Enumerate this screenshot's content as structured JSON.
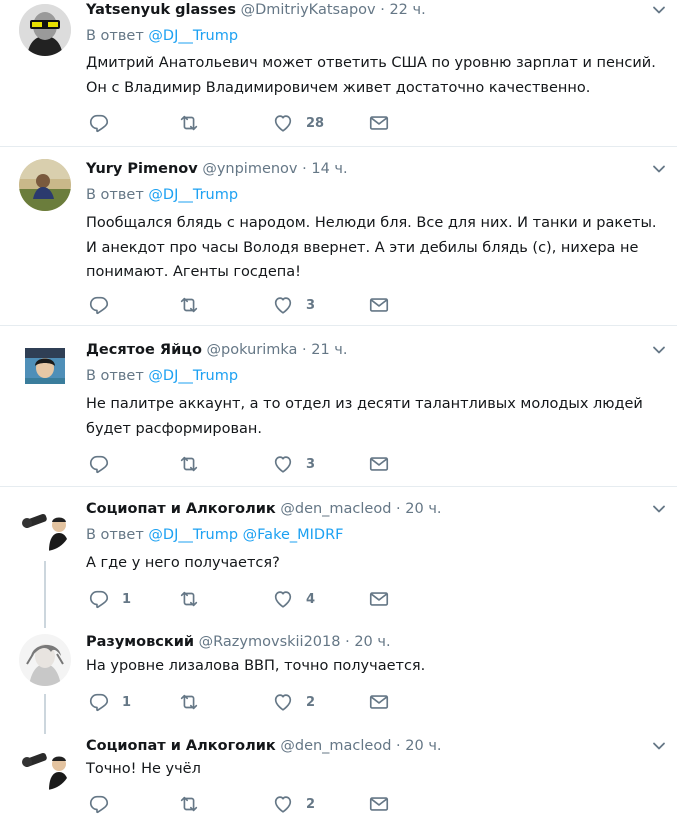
{
  "reply_prefix": "В ответ",
  "tweets": [
    {
      "name": "Yatsenyuk glasses",
      "handle": "@DmitriyKatsapov",
      "time": "22 ч.",
      "reply_to": [
        "@DJ__Trump"
      ],
      "text": "Дмитрий Анатольевич может ответить США по уровню зарплат и пенсий. Он с Владимир Владимировичем живет достаточно качественно.",
      "replies": "",
      "retweets": "",
      "likes": "28"
    },
    {
      "name": "Yury Pimenov",
      "handle": "@ynpimenov",
      "time": "14 ч.",
      "reply_to": [
        "@DJ__Trump"
      ],
      "text": "Пообщался блядь с народом. Нелюди бля. Все для них. И танки и ракеты. И анекдот про часы Володя ввернет. А эти дебилы блядь (с), нихера не понимают. Агенты госдепа!",
      "replies": "",
      "retweets": "",
      "likes": "3"
    },
    {
      "name": "Десятое Яйцо",
      "handle": "@pokurimka",
      "time": "21 ч.",
      "reply_to": [
        "@DJ__Trump"
      ],
      "text": "Не палитре аккаунт, а то отдел из десяти талантливых молодых людей будет расформирован.",
      "replies": "",
      "retweets": "",
      "likes": "3"
    },
    {
      "name": "Социопат и Алкоголик",
      "handle": "@den_macleod",
      "time": "20 ч.",
      "reply_to": [
        "@DJ__Trump",
        "@Fake_MIDRF"
      ],
      "text": "А где у него получается?",
      "replies": "1",
      "retweets": "",
      "likes": "4"
    },
    {
      "name": "Разумовский",
      "handle": "@Razymovskii2018",
      "time": "20 ч.",
      "reply_to": [],
      "text": "На уровне лизалова ВВП, точно получается.",
      "replies": "1",
      "retweets": "",
      "likes": "2"
    },
    {
      "name": "Социопат и Алкоголик",
      "handle": "@den_macleod",
      "time": "20 ч.",
      "reply_to": [],
      "text": "Точно! Не учёл",
      "replies": "",
      "retweets": "",
      "likes": "2"
    }
  ],
  "colors": {
    "link": "#1da1f2",
    "secondary": "#657786",
    "text": "#14171a",
    "separator": "#e6ecf0"
  },
  "icons": {
    "reply": "reply-icon",
    "retweet": "retweet-icon",
    "like": "heart-icon",
    "dm": "envelope-icon",
    "menu": "chevron-down-icon"
  }
}
